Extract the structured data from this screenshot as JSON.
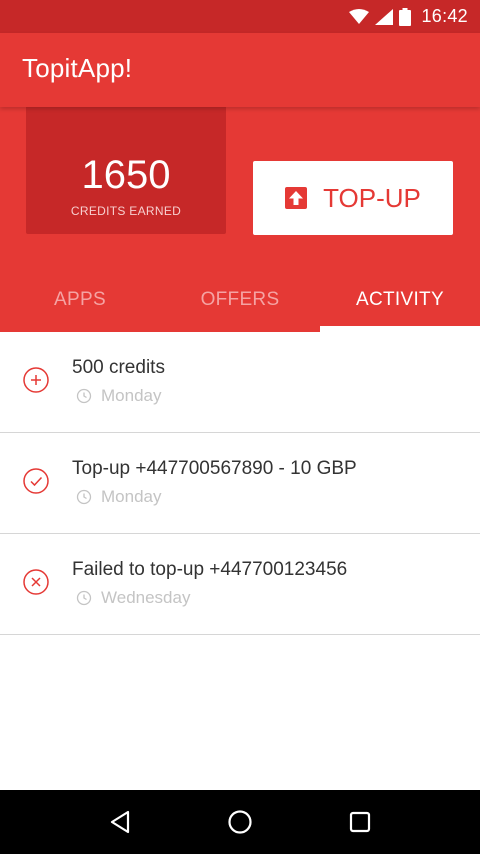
{
  "status_bar": {
    "time": "16:42"
  },
  "app_bar": {
    "title": "TopitApp!"
  },
  "credits": {
    "value": "1650",
    "label": "CREDITS EARNED"
  },
  "topup_button": {
    "label": "TOP-UP"
  },
  "tabs": [
    {
      "label": "APPS",
      "active": false
    },
    {
      "label": "OFFERS",
      "active": false
    },
    {
      "label": "ACTIVITY",
      "active": true
    }
  ],
  "activity": [
    {
      "icon": "plus-circle-icon",
      "title": "500 credits",
      "date": "Monday"
    },
    {
      "icon": "check-circle-icon",
      "title": "Top-up +447700567890 - 10 GBP",
      "date": "Monday"
    },
    {
      "icon": "cross-circle-icon",
      "title": "Failed to top-up +447700123456",
      "date": "Wednesday"
    }
  ],
  "colors": {
    "primary": "#e53935",
    "primary_dark": "#c62828",
    "muted_text": "#c4c4c4"
  }
}
